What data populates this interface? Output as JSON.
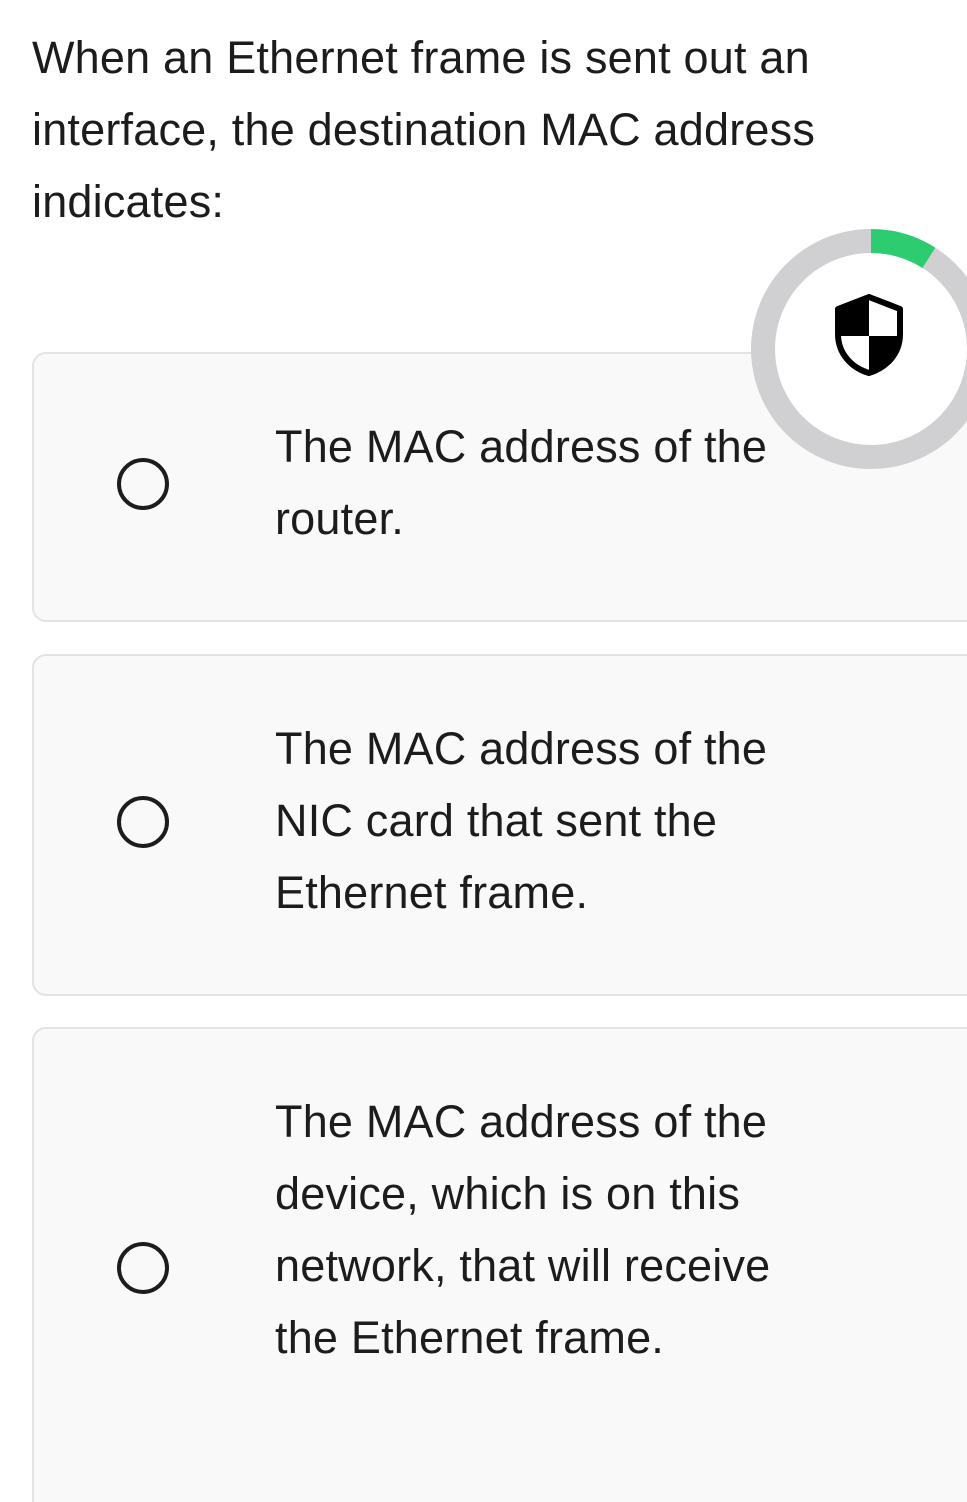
{
  "question": {
    "text": "When an Ethernet frame is sent out an interface, the destination MAC address indicates:"
  },
  "options": [
    {
      "label": "The MAC address of the router.",
      "selected": false
    },
    {
      "label": "The MAC address of the NIC card that sent the Ethernet frame.",
      "selected": false
    },
    {
      "label": "The MAC address of the device, which is on this network, that will receive the Ethernet frame.",
      "selected": false
    }
  ],
  "security_widget": {
    "icon": "shield-icon",
    "progress": 0.09,
    "progress_color": "#2ecc71",
    "track_color": "#d0d0d2"
  }
}
